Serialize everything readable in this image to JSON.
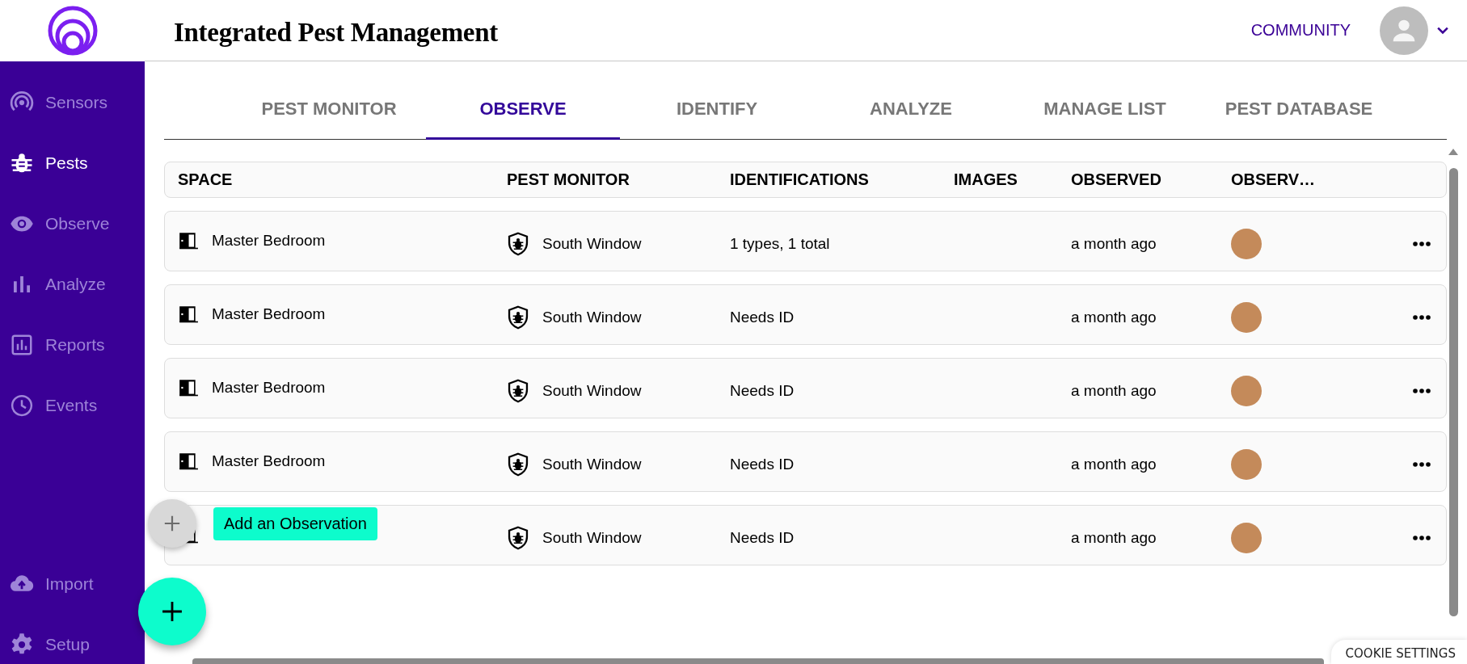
{
  "header": {
    "title": "Integrated Pest Management",
    "community_link": "COMMUNITY"
  },
  "sidebar": {
    "items": [
      {
        "label": "Sensors",
        "kind": "sensors",
        "selected": false
      },
      {
        "label": "Pests",
        "kind": "pests",
        "selected": true
      },
      {
        "label": "Observe",
        "kind": "observe",
        "selected": false
      },
      {
        "label": "Analyze",
        "kind": "analyze",
        "selected": false
      },
      {
        "label": "Reports",
        "kind": "reports",
        "selected": false
      },
      {
        "label": "Events",
        "kind": "events",
        "selected": false
      }
    ],
    "bottom_items": [
      {
        "label": "Import",
        "kind": "import",
        "selected": false
      },
      {
        "label": "Setup",
        "kind": "setup",
        "selected": false
      }
    ]
  },
  "tabs": [
    {
      "label": "PEST MONITOR",
      "selected": false
    },
    {
      "label": "OBSERVE",
      "selected": true
    },
    {
      "label": "IDENTIFY",
      "selected": false
    },
    {
      "label": "ANALYZE",
      "selected": false
    },
    {
      "label": "MANAGE LIST",
      "selected": false
    },
    {
      "label": "PEST DATABASE",
      "selected": false
    }
  ],
  "table": {
    "columns": [
      "SPACE",
      "PEST MONITOR",
      "IDENTIFICATIONS",
      "IMAGES",
      "OBSERVED",
      "OBSERV…"
    ],
    "rows": [
      {
        "space": "Master Bedroom",
        "pest_monitor": "South Window",
        "identifications": "1 types, 1 total",
        "observed": "a month ago"
      },
      {
        "space": "Master Bedroom",
        "pest_monitor": "South Window",
        "identifications": "Needs ID",
        "observed": "a month ago"
      },
      {
        "space": "Master Bedroom",
        "pest_monitor": "South Window",
        "identifications": "Needs ID",
        "observed": "a month ago"
      },
      {
        "space": "Master Bedroom",
        "pest_monitor": "South Window",
        "identifications": "Needs ID",
        "observed": "a month ago"
      },
      {
        "pest_monitor": "South Window",
        "identifications": "Needs ID",
        "observed": "a month ago"
      }
    ]
  },
  "fab": {
    "tooltip": "Add an Observation"
  },
  "cookie_button": "COOKIE SETTINGS"
}
